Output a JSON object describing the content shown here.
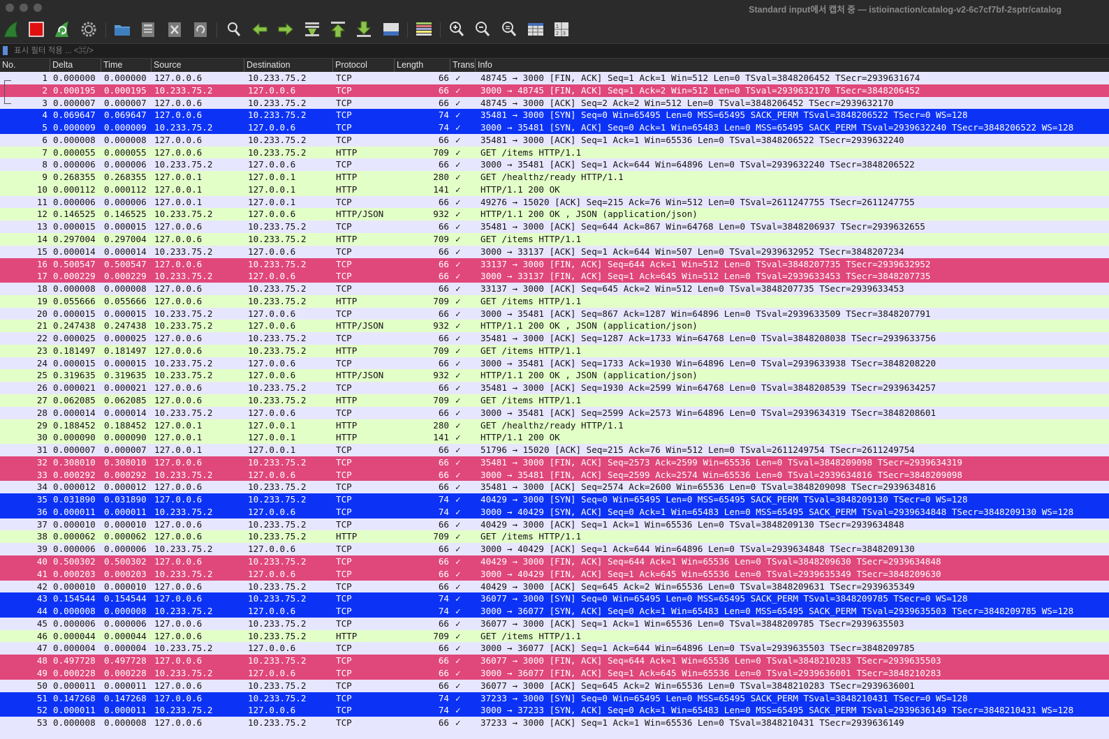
{
  "window": {
    "title": "Standard input에서 캡처 중 — istioinaction/catalog-v2-6c7cf7bf-2sptr/catalog"
  },
  "toolbar": {
    "buttons": [
      {
        "name": "start-capture-button",
        "icon": "shark-fin-icon"
      },
      {
        "name": "stop-capture-button",
        "icon": "stop-icon"
      },
      {
        "name": "restart-capture-button",
        "icon": "restart-shark-fin-icon"
      },
      {
        "name": "capture-options-button",
        "icon": "gear-icon"
      },
      {
        "name": "open-file-button",
        "icon": "folder-icon"
      },
      {
        "name": "save-file-button",
        "icon": "save-icon"
      },
      {
        "name": "close-file-button",
        "icon": "close-file-icon"
      },
      {
        "name": "reload-file-button",
        "icon": "reload-icon"
      },
      {
        "name": "find-packet-button",
        "icon": "magnifier-icon"
      },
      {
        "name": "go-back-button",
        "icon": "arrow-left-icon"
      },
      {
        "name": "go-forward-button",
        "icon": "arrow-right-icon"
      },
      {
        "name": "go-to-packet-button",
        "icon": "go-to-packet-icon"
      },
      {
        "name": "first-packet-button",
        "icon": "arrow-up-to-top-icon"
      },
      {
        "name": "last-packet-button",
        "icon": "arrow-down-to-bottom-icon"
      },
      {
        "name": "autoscroll-button",
        "icon": "autoscroll-icon"
      },
      {
        "name": "colorize-button",
        "icon": "colorize-icon"
      },
      {
        "name": "zoom-in-button",
        "icon": "zoom-in-icon"
      },
      {
        "name": "zoom-out-button",
        "icon": "zoom-out-icon"
      },
      {
        "name": "normal-size-button",
        "icon": "zoom-reset-icon"
      },
      {
        "name": "resize-columns-button",
        "icon": "resize-columns-icon"
      },
      {
        "name": "extra-button",
        "icon": "number-grid-icon"
      }
    ]
  },
  "filter": {
    "placeholder": "표시 필터 적용 ... <⌘/>",
    "value": ""
  },
  "columns": [
    "No.",
    "Delta",
    "Time",
    "Source",
    "Destination",
    "Protocol",
    "Length",
    "Trans",
    "Info"
  ],
  "colors": {
    "fin": {
      "bg": "#e0477a",
      "fg": "#ffffff"
    },
    "syn": {
      "bg": "#0c33f5",
      "fg": "#ffffff"
    },
    "tcp": {
      "bg": "#e7e6ff",
      "fg": "#141414"
    },
    "http": {
      "bg": "#e3ffc8",
      "fg": "#141414"
    },
    "header_bg": "#2a2a2a",
    "toolbar_bg": "#2b2b2b"
  },
  "packets": [
    {
      "no": "1",
      "delta": "0.000000",
      "time": "0.000000",
      "src": "127.0.0.6",
      "dst": "10.233.75.2",
      "proto": "TCP",
      "len": "66",
      "trans": "✓",
      "info": "48745 → 3000 [FIN, ACK] Seq=1 Ack=1 Win=512 Len=0 TSval=3848206452 TSecr=2939631674",
      "style": "tcp"
    },
    {
      "no": "2",
      "delta": "0.000195",
      "time": "0.000195",
      "src": "10.233.75.2",
      "dst": "127.0.0.6",
      "proto": "TCP",
      "len": "66",
      "trans": "✓",
      "info": "3000 → 48745 [FIN, ACK] Seq=1 Ack=2 Win=512 Len=0 TSval=2939632170 TSecr=3848206452",
      "style": "fin"
    },
    {
      "no": "3",
      "delta": "0.000007",
      "time": "0.000007",
      "src": "127.0.0.6",
      "dst": "10.233.75.2",
      "proto": "TCP",
      "len": "66",
      "trans": "✓",
      "info": "48745 → 3000 [ACK] Seq=2 Ack=2 Win=512 Len=0 TSval=3848206452 TSecr=2939632170",
      "style": "tcp"
    },
    {
      "no": "4",
      "delta": "0.069647",
      "time": "0.069647",
      "src": "127.0.0.6",
      "dst": "10.233.75.2",
      "proto": "TCP",
      "len": "74",
      "trans": "✓",
      "info": "35481 → 3000 [SYN] Seq=0 Win=65495 Len=0 MSS=65495 SACK_PERM TSval=3848206522 TSecr=0 WS=128",
      "style": "syn"
    },
    {
      "no": "5",
      "delta": "0.000009",
      "time": "0.000009",
      "src": "10.233.75.2",
      "dst": "127.0.0.6",
      "proto": "TCP",
      "len": "74",
      "trans": "✓",
      "info": "3000 → 35481 [SYN, ACK] Seq=0 Ack=1 Win=65483 Len=0 MSS=65495 SACK_PERM TSval=2939632240 TSecr=3848206522 WS=128",
      "style": "syn"
    },
    {
      "no": "6",
      "delta": "0.000008",
      "time": "0.000008",
      "src": "127.0.0.6",
      "dst": "10.233.75.2",
      "proto": "TCP",
      "len": "66",
      "trans": "✓",
      "info": "35481 → 3000 [ACK] Seq=1 Ack=1 Win=65536 Len=0 TSval=3848206522 TSecr=2939632240",
      "style": "tcp"
    },
    {
      "no": "7",
      "delta": "0.000055",
      "time": "0.000055",
      "src": "127.0.0.6",
      "dst": "10.233.75.2",
      "proto": "HTTP",
      "len": "709",
      "trans": "✓",
      "info": "GET /items HTTP/1.1",
      "style": "http"
    },
    {
      "no": "8",
      "delta": "0.000006",
      "time": "0.000006",
      "src": "10.233.75.2",
      "dst": "127.0.0.6",
      "proto": "TCP",
      "len": "66",
      "trans": "✓",
      "info": "3000 → 35481 [ACK] Seq=1 Ack=644 Win=64896 Len=0 TSval=2939632240 TSecr=3848206522",
      "style": "tcp"
    },
    {
      "no": "9",
      "delta": "0.268355",
      "time": "0.268355",
      "src": "127.0.0.1",
      "dst": "127.0.0.1",
      "proto": "HTTP",
      "len": "280",
      "trans": "✓",
      "info": "GET /healthz/ready HTTP/1.1",
      "style": "http"
    },
    {
      "no": "10",
      "delta": "0.000112",
      "time": "0.000112",
      "src": "127.0.0.1",
      "dst": "127.0.0.1",
      "proto": "HTTP",
      "len": "141",
      "trans": "✓",
      "info": "HTTP/1.1 200 OK",
      "style": "http"
    },
    {
      "no": "11",
      "delta": "0.000006",
      "time": "0.000006",
      "src": "127.0.0.1",
      "dst": "127.0.0.1",
      "proto": "TCP",
      "len": "66",
      "trans": "✓",
      "info": "49276 → 15020 [ACK] Seq=215 Ack=76 Win=512 Len=0 TSval=2611247755 TSecr=2611247755",
      "style": "tcp"
    },
    {
      "no": "12",
      "delta": "0.146525",
      "time": "0.146525",
      "src": "10.233.75.2",
      "dst": "127.0.0.6",
      "proto": "HTTP/JSON",
      "len": "932",
      "trans": "✓",
      "info": "HTTP/1.1 200 OK , JSON (application/json)",
      "style": "http"
    },
    {
      "no": "13",
      "delta": "0.000015",
      "time": "0.000015",
      "src": "127.0.0.6",
      "dst": "10.233.75.2",
      "proto": "TCP",
      "len": "66",
      "trans": "✓",
      "info": "35481 → 3000 [ACK] Seq=644 Ack=867 Win=64768 Len=0 TSval=3848206937 TSecr=2939632655",
      "style": "tcp"
    },
    {
      "no": "14",
      "delta": "0.297004",
      "time": "0.297004",
      "src": "127.0.0.6",
      "dst": "10.233.75.2",
      "proto": "HTTP",
      "len": "709",
      "trans": "✓",
      "info": "GET /items HTTP/1.1",
      "style": "http"
    },
    {
      "no": "15",
      "delta": "0.000014",
      "time": "0.000014",
      "src": "10.233.75.2",
      "dst": "127.0.0.6",
      "proto": "TCP",
      "len": "66",
      "trans": "✓",
      "info": "3000 → 33137 [ACK] Seq=1 Ack=644 Win=507 Len=0 TSval=2939632952 TSecr=3848207234",
      "style": "tcp"
    },
    {
      "no": "16",
      "delta": "0.500547",
      "time": "0.500547",
      "src": "127.0.0.6",
      "dst": "10.233.75.2",
      "proto": "TCP",
      "len": "66",
      "trans": "✓",
      "info": "33137 → 3000 [FIN, ACK] Seq=644 Ack=1 Win=512 Len=0 TSval=3848207735 TSecr=2939632952",
      "style": "fin"
    },
    {
      "no": "17",
      "delta": "0.000229",
      "time": "0.000229",
      "src": "10.233.75.2",
      "dst": "127.0.0.6",
      "proto": "TCP",
      "len": "66",
      "trans": "✓",
      "info": "3000 → 33137 [FIN, ACK] Seq=1 Ack=645 Win=512 Len=0 TSval=2939633453 TSecr=3848207735",
      "style": "fin"
    },
    {
      "no": "18",
      "delta": "0.000008",
      "time": "0.000008",
      "src": "127.0.0.6",
      "dst": "10.233.75.2",
      "proto": "TCP",
      "len": "66",
      "trans": "✓",
      "info": "33137 → 3000 [ACK] Seq=645 Ack=2 Win=512 Len=0 TSval=3848207735 TSecr=2939633453",
      "style": "tcp"
    },
    {
      "no": "19",
      "delta": "0.055666",
      "time": "0.055666",
      "src": "127.0.0.6",
      "dst": "10.233.75.2",
      "proto": "HTTP",
      "len": "709",
      "trans": "✓",
      "info": "GET /items HTTP/1.1",
      "style": "http"
    },
    {
      "no": "20",
      "delta": "0.000015",
      "time": "0.000015",
      "src": "10.233.75.2",
      "dst": "127.0.0.6",
      "proto": "TCP",
      "len": "66",
      "trans": "✓",
      "info": "3000 → 35481 [ACK] Seq=867 Ack=1287 Win=64896 Len=0 TSval=2939633509 TSecr=3848207791",
      "style": "tcp"
    },
    {
      "no": "21",
      "delta": "0.247438",
      "time": "0.247438",
      "src": "10.233.75.2",
      "dst": "127.0.0.6",
      "proto": "HTTP/JSON",
      "len": "932",
      "trans": "✓",
      "info": "HTTP/1.1 200 OK , JSON (application/json)",
      "style": "http"
    },
    {
      "no": "22",
      "delta": "0.000025",
      "time": "0.000025",
      "src": "127.0.0.6",
      "dst": "10.233.75.2",
      "proto": "TCP",
      "len": "66",
      "trans": "✓",
      "info": "35481 → 3000 [ACK] Seq=1287 Ack=1733 Win=64768 Len=0 TSval=3848208038 TSecr=2939633756",
      "style": "tcp"
    },
    {
      "no": "23",
      "delta": "0.181497",
      "time": "0.181497",
      "src": "127.0.0.6",
      "dst": "10.233.75.2",
      "proto": "HTTP",
      "len": "709",
      "trans": "✓",
      "info": "GET /items HTTP/1.1",
      "style": "http"
    },
    {
      "no": "24",
      "delta": "0.000015",
      "time": "0.000015",
      "src": "10.233.75.2",
      "dst": "127.0.0.6",
      "proto": "TCP",
      "len": "66",
      "trans": "✓",
      "info": "3000 → 35481 [ACK] Seq=1733 Ack=1930 Win=64896 Len=0 TSval=2939633938 TSecr=3848208220",
      "style": "tcp"
    },
    {
      "no": "25",
      "delta": "0.319635",
      "time": "0.319635",
      "src": "10.233.75.2",
      "dst": "127.0.0.6",
      "proto": "HTTP/JSON",
      "len": "932",
      "trans": "✓",
      "info": "HTTP/1.1 200 OK , JSON (application/json)",
      "style": "http"
    },
    {
      "no": "26",
      "delta": "0.000021",
      "time": "0.000021",
      "src": "127.0.0.6",
      "dst": "10.233.75.2",
      "proto": "TCP",
      "len": "66",
      "trans": "✓",
      "info": "35481 → 3000 [ACK] Seq=1930 Ack=2599 Win=64768 Len=0 TSval=3848208539 TSecr=2939634257",
      "style": "tcp"
    },
    {
      "no": "27",
      "delta": "0.062085",
      "time": "0.062085",
      "src": "127.0.0.6",
      "dst": "10.233.75.2",
      "proto": "HTTP",
      "len": "709",
      "trans": "✓",
      "info": "GET /items HTTP/1.1",
      "style": "http"
    },
    {
      "no": "28",
      "delta": "0.000014",
      "time": "0.000014",
      "src": "10.233.75.2",
      "dst": "127.0.0.6",
      "proto": "TCP",
      "len": "66",
      "trans": "✓",
      "info": "3000 → 35481 [ACK] Seq=2599 Ack=2573 Win=64896 Len=0 TSval=2939634319 TSecr=3848208601",
      "style": "tcp"
    },
    {
      "no": "29",
      "delta": "0.188452",
      "time": "0.188452",
      "src": "127.0.0.1",
      "dst": "127.0.0.1",
      "proto": "HTTP",
      "len": "280",
      "trans": "✓",
      "info": "GET /healthz/ready HTTP/1.1",
      "style": "http"
    },
    {
      "no": "30",
      "delta": "0.000090",
      "time": "0.000090",
      "src": "127.0.0.1",
      "dst": "127.0.0.1",
      "proto": "HTTP",
      "len": "141",
      "trans": "✓",
      "info": "HTTP/1.1 200 OK",
      "style": "http"
    },
    {
      "no": "31",
      "delta": "0.000007",
      "time": "0.000007",
      "src": "127.0.0.1",
      "dst": "127.0.0.1",
      "proto": "TCP",
      "len": "66",
      "trans": "✓",
      "info": "51796 → 15020 [ACK] Seq=215 Ack=76 Win=512 Len=0 TSval=2611249754 TSecr=2611249754",
      "style": "tcp"
    },
    {
      "no": "32",
      "delta": "0.308010",
      "time": "0.308010",
      "src": "127.0.0.6",
      "dst": "10.233.75.2",
      "proto": "TCP",
      "len": "66",
      "trans": "✓",
      "info": "35481 → 3000 [FIN, ACK] Seq=2573 Ack=2599 Win=65536 Len=0 TSval=3848209098 TSecr=2939634319",
      "style": "fin"
    },
    {
      "no": "33",
      "delta": "0.000292",
      "time": "0.000292",
      "src": "10.233.75.2",
      "dst": "127.0.0.6",
      "proto": "TCP",
      "len": "66",
      "trans": "✓",
      "info": "3000 → 35481 [FIN, ACK] Seq=2599 Ack=2574 Win=65536 Len=0 TSval=2939634816 TSecr=3848209098",
      "style": "fin"
    },
    {
      "no": "34",
      "delta": "0.000012",
      "time": "0.000012",
      "src": "127.0.0.6",
      "dst": "10.233.75.2",
      "proto": "TCP",
      "len": "66",
      "trans": "✓",
      "info": "35481 → 3000 [ACK] Seq=2574 Ack=2600 Win=65536 Len=0 TSval=3848209098 TSecr=2939634816",
      "style": "tcp"
    },
    {
      "no": "35",
      "delta": "0.031890",
      "time": "0.031890",
      "src": "127.0.0.6",
      "dst": "10.233.75.2",
      "proto": "TCP",
      "len": "74",
      "trans": "✓",
      "info": "40429 → 3000 [SYN] Seq=0 Win=65495 Len=0 MSS=65495 SACK_PERM TSval=3848209130 TSecr=0 WS=128",
      "style": "syn"
    },
    {
      "no": "36",
      "delta": "0.000011",
      "time": "0.000011",
      "src": "10.233.75.2",
      "dst": "127.0.0.6",
      "proto": "TCP",
      "len": "74",
      "trans": "✓",
      "info": "3000 → 40429 [SYN, ACK] Seq=0 Ack=1 Win=65483 Len=0 MSS=65495 SACK_PERM TSval=2939634848 TSecr=3848209130 WS=128",
      "style": "syn"
    },
    {
      "no": "37",
      "delta": "0.000010",
      "time": "0.000010",
      "src": "127.0.0.6",
      "dst": "10.233.75.2",
      "proto": "TCP",
      "len": "66",
      "trans": "✓",
      "info": "40429 → 3000 [ACK] Seq=1 Ack=1 Win=65536 Len=0 TSval=3848209130 TSecr=2939634848",
      "style": "tcp"
    },
    {
      "no": "38",
      "delta": "0.000062",
      "time": "0.000062",
      "src": "127.0.0.6",
      "dst": "10.233.75.2",
      "proto": "HTTP",
      "len": "709",
      "trans": "✓",
      "info": "GET /items HTTP/1.1",
      "style": "http"
    },
    {
      "no": "39",
      "delta": "0.000006",
      "time": "0.000006",
      "src": "10.233.75.2",
      "dst": "127.0.0.6",
      "proto": "TCP",
      "len": "66",
      "trans": "✓",
      "info": "3000 → 40429 [ACK] Seq=1 Ack=644 Win=64896 Len=0 TSval=2939634848 TSecr=3848209130",
      "style": "tcp"
    },
    {
      "no": "40",
      "delta": "0.500302",
      "time": "0.500302",
      "src": "127.0.0.6",
      "dst": "10.233.75.2",
      "proto": "TCP",
      "len": "66",
      "trans": "✓",
      "info": "40429 → 3000 [FIN, ACK] Seq=644 Ack=1 Win=65536 Len=0 TSval=3848209630 TSecr=2939634848",
      "style": "fin"
    },
    {
      "no": "41",
      "delta": "0.000203",
      "time": "0.000203",
      "src": "10.233.75.2",
      "dst": "127.0.0.6",
      "proto": "TCP",
      "len": "66",
      "trans": "✓",
      "info": "3000 → 40429 [FIN, ACK] Seq=1 Ack=645 Win=65536 Len=0 TSval=2939635349 TSecr=3848209630",
      "style": "fin"
    },
    {
      "no": "42",
      "delta": "0.000010",
      "time": "0.000010",
      "src": "127.0.0.6",
      "dst": "10.233.75.2",
      "proto": "TCP",
      "len": "66",
      "trans": "✓",
      "info": "40429 → 3000 [ACK] Seq=645 Ack=2 Win=65536 Len=0 TSval=3848209631 TSecr=2939635349",
      "style": "tcp"
    },
    {
      "no": "43",
      "delta": "0.154544",
      "time": "0.154544",
      "src": "127.0.0.6",
      "dst": "10.233.75.2",
      "proto": "TCP",
      "len": "74",
      "trans": "✓",
      "info": "36077 → 3000 [SYN] Seq=0 Win=65495 Len=0 MSS=65495 SACK_PERM TSval=3848209785 TSecr=0 WS=128",
      "style": "syn"
    },
    {
      "no": "44",
      "delta": "0.000008",
      "time": "0.000008",
      "src": "10.233.75.2",
      "dst": "127.0.0.6",
      "proto": "TCP",
      "len": "74",
      "trans": "✓",
      "info": "3000 → 36077 [SYN, ACK] Seq=0 Ack=1 Win=65483 Len=0 MSS=65495 SACK_PERM TSval=2939635503 TSecr=3848209785 WS=128",
      "style": "syn"
    },
    {
      "no": "45",
      "delta": "0.000006",
      "time": "0.000006",
      "src": "127.0.0.6",
      "dst": "10.233.75.2",
      "proto": "TCP",
      "len": "66",
      "trans": "✓",
      "info": "36077 → 3000 [ACK] Seq=1 Ack=1 Win=65536 Len=0 TSval=3848209785 TSecr=2939635503",
      "style": "tcp"
    },
    {
      "no": "46",
      "delta": "0.000044",
      "time": "0.000044",
      "src": "127.0.0.6",
      "dst": "10.233.75.2",
      "proto": "HTTP",
      "len": "709",
      "trans": "✓",
      "info": "GET /items HTTP/1.1",
      "style": "http"
    },
    {
      "no": "47",
      "delta": "0.000004",
      "time": "0.000004",
      "src": "10.233.75.2",
      "dst": "127.0.0.6",
      "proto": "TCP",
      "len": "66",
      "trans": "✓",
      "info": "3000 → 36077 [ACK] Seq=1 Ack=644 Win=64896 Len=0 TSval=2939635503 TSecr=3848209785",
      "style": "tcp"
    },
    {
      "no": "48",
      "delta": "0.497728",
      "time": "0.497728",
      "src": "127.0.0.6",
      "dst": "10.233.75.2",
      "proto": "TCP",
      "len": "66",
      "trans": "✓",
      "info": "36077 → 3000 [FIN, ACK] Seq=644 Ack=1 Win=65536 Len=0 TSval=3848210283 TSecr=2939635503",
      "style": "fin"
    },
    {
      "no": "49",
      "delta": "0.000228",
      "time": "0.000228",
      "src": "10.233.75.2",
      "dst": "127.0.0.6",
      "proto": "TCP",
      "len": "66",
      "trans": "✓",
      "info": "3000 → 36077 [FIN, ACK] Seq=1 Ack=645 Win=65536 Len=0 TSval=2939636001 TSecr=3848210283",
      "style": "fin"
    },
    {
      "no": "50",
      "delta": "0.000011",
      "time": "0.000011",
      "src": "127.0.0.6",
      "dst": "10.233.75.2",
      "proto": "TCP",
      "len": "66",
      "trans": "✓",
      "info": "36077 → 3000 [ACK] Seq=645 Ack=2 Win=65536 Len=0 TSval=3848210283 TSecr=2939636001",
      "style": "tcp"
    },
    {
      "no": "51",
      "delta": "0.147268",
      "time": "0.147268",
      "src": "127.0.0.6",
      "dst": "10.233.75.2",
      "proto": "TCP",
      "len": "74",
      "trans": "✓",
      "info": "37233 → 3000 [SYN] Seq=0 Win=65495 Len=0 MSS=65495 SACK_PERM TSval=3848210431 TSecr=0 WS=128",
      "style": "syn"
    },
    {
      "no": "52",
      "delta": "0.000011",
      "time": "0.000011",
      "src": "10.233.75.2",
      "dst": "127.0.0.6",
      "proto": "TCP",
      "len": "74",
      "trans": "✓",
      "info": "3000 → 37233 [SYN, ACK] Seq=0 Ack=1 Win=65483 Len=0 MSS=65495 SACK_PERM TSval=2939636149 TSecr=3848210431 WS=128",
      "style": "syn"
    },
    {
      "no": "53",
      "delta": "0.000008",
      "time": "0.000008",
      "src": "127.0.0.6",
      "dst": "10.233.75.2",
      "proto": "TCP",
      "len": "66",
      "trans": "✓",
      "info": "37233 → 3000 [ACK] Seq=1 Ack=1 Win=65536 Len=0 TSval=3848210431 TSecr=2939636149",
      "style": "tcp"
    }
  ]
}
